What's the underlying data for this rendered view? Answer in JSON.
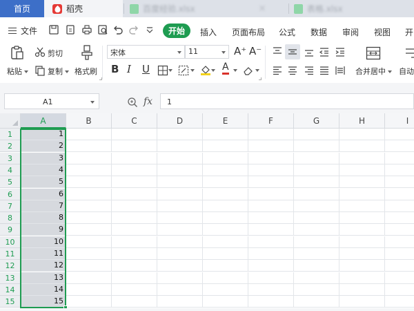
{
  "tabs": {
    "home": "首页",
    "daoke": "稻壳",
    "file1": "百度经验.xlsx",
    "file2": "表格.xlsx",
    "close_symbol": "×"
  },
  "menu": {
    "file": "文件",
    "tabs": [
      "开始",
      "插入",
      "页面布局",
      "公式",
      "数据",
      "审阅",
      "视图",
      "开"
    ],
    "active_tab": "开始"
  },
  "ribbon": {
    "paste": "粘贴",
    "cut": "剪切",
    "copy": "复制",
    "format_painter": "格式刷",
    "font_name": "宋体",
    "font_size": "11",
    "grow_font": "A⁺",
    "shrink_font": "A⁻",
    "bold": "B",
    "italic": "I",
    "underline": "U",
    "font_color": "A",
    "merge_center": "合并居中",
    "auto_wrap": "自动"
  },
  "formula_bar": {
    "cell_ref": "A1",
    "fx": "fx",
    "value": "1"
  },
  "sheet": {
    "columns": [
      "A",
      "B",
      "C",
      "D",
      "E",
      "F",
      "G",
      "H",
      "I"
    ],
    "selected_column": "A",
    "rows": [
      "1",
      "2",
      "3",
      "4",
      "5",
      "6",
      "7",
      "8",
      "9",
      "10",
      "11",
      "12",
      "13",
      "14",
      "15"
    ],
    "column_a_values": [
      "1",
      "2",
      "3",
      "4",
      "5",
      "6",
      "7",
      "8",
      "9",
      "10",
      "11",
      "12",
      "13",
      "14",
      "15"
    ]
  },
  "colors": {
    "accent_green": "#1e9c51",
    "home_tab_blue": "#3d6fc8",
    "selection_fill": "#d6d9de"
  }
}
